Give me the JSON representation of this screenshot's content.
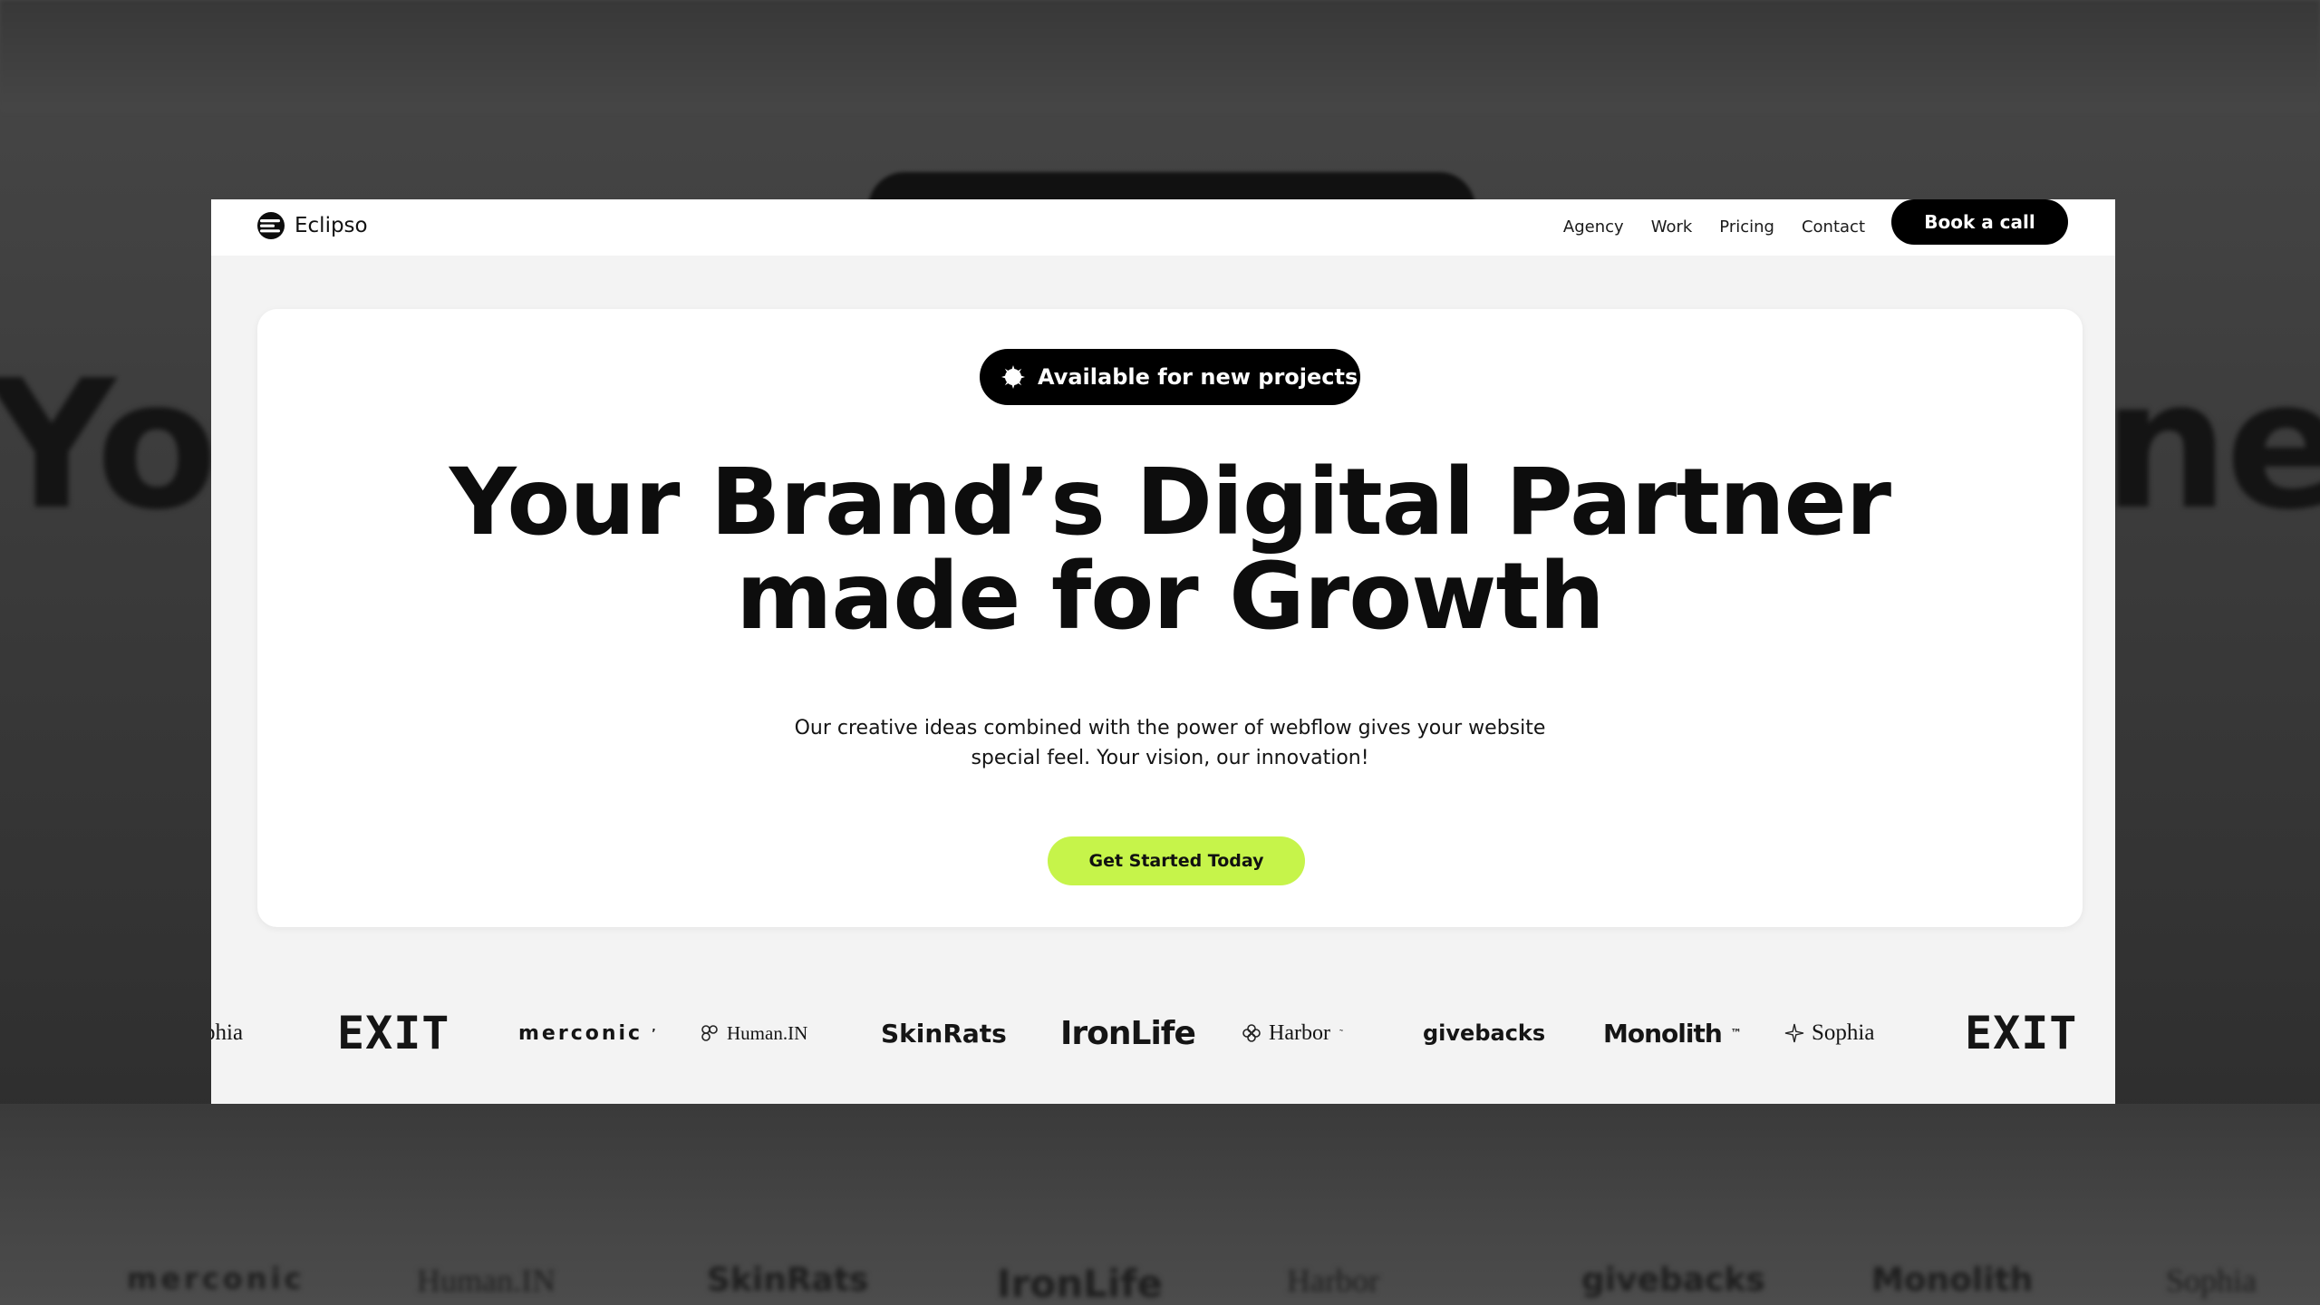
{
  "backdrop": {
    "big_text_left": "You",
    "big_text_right": "ne",
    "logos": [
      "merconic",
      "Human.IN",
      "SkinRats",
      "IronLife",
      "Harbor",
      "givebacks",
      "Monolith",
      "Sophia"
    ]
  },
  "nav": {
    "brand": "Eclipso",
    "brand_icon": "eclipso-logo-icon",
    "links": [
      "Agency",
      "Work",
      "Pricing",
      "Contact"
    ],
    "cta": "Book a call"
  },
  "hero": {
    "badge_icon": "sun-burst-icon",
    "badge_text": "Available for new projects",
    "headline_line1": "Your Brand’s Digital Partner",
    "headline_line2": "made for Growth",
    "subtext_line1": "Our creative ideas combined with the power of webflow gives your website",
    "subtext_line2": "special feel. Your vision, our innovation!",
    "cta": "Get Started Today"
  },
  "clients": {
    "logos": [
      "phia",
      "EXIT",
      "merconic",
      "Human.IN",
      "SkinRats",
      "IronLife",
      "Harbor",
      "givebacks",
      "Monolith",
      "Sophia",
      "EXIT"
    ],
    "trademark_logos": [
      "merconic",
      "Harbor",
      "Monolith"
    ]
  },
  "colors": {
    "accent": "#c6f44a",
    "primary": "#000000",
    "window_bg": "#f3f3f3",
    "card_bg": "#ffffff"
  }
}
